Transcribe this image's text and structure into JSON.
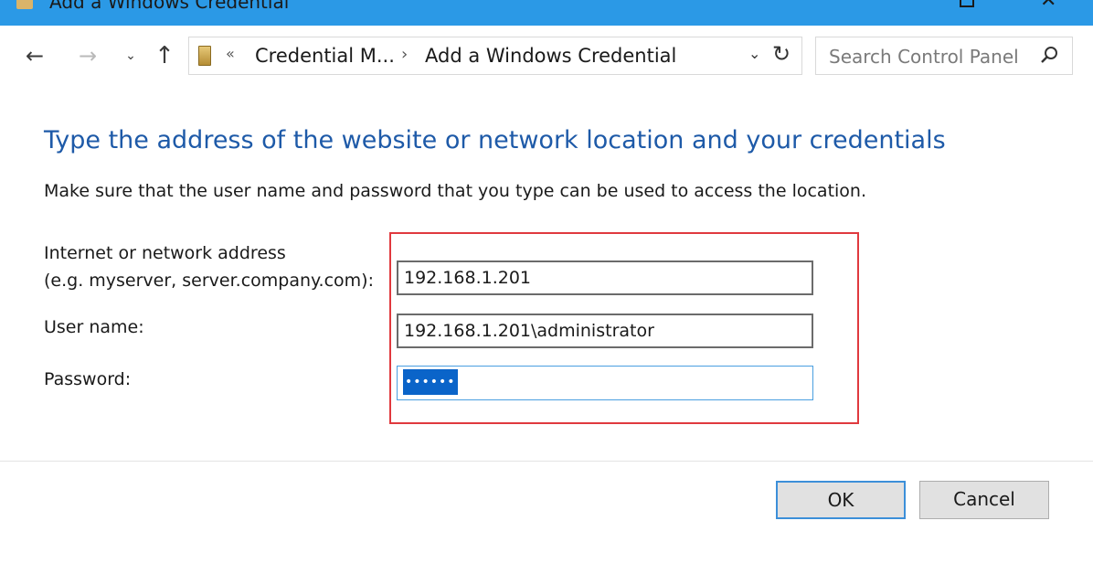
{
  "window": {
    "title": "Add a Windows Credential"
  },
  "navigation": {
    "back_icon": "arrow-left",
    "forward_icon": "arrow-right",
    "recent_icon": "chevron-down",
    "up_icon": "arrow-up",
    "breadcrumbs": [
      "Credential M...",
      "Add a Windows Credential"
    ],
    "search_placeholder": "Search Control Panel"
  },
  "main": {
    "heading": "Type the address of the website or network location and your credentials",
    "description": "Make sure that the user name and password that you type can be used to access the location.",
    "fields": {
      "address_label_line1": "Internet or network address",
      "address_label_line2": "(e.g. myserver, server.company.com):",
      "address_value": "192.168.1.201",
      "username_label": "User name:",
      "username_value": "192.168.1.201\\administrator",
      "password_label": "Password:",
      "password_value": "••••••"
    }
  },
  "buttons": {
    "ok": "OK",
    "cancel": "Cancel"
  },
  "colors": {
    "title_bar": "#2b99e6",
    "heading": "#1e5aa8",
    "highlight_border": "#e0393e",
    "selection": "#0a64c9"
  }
}
